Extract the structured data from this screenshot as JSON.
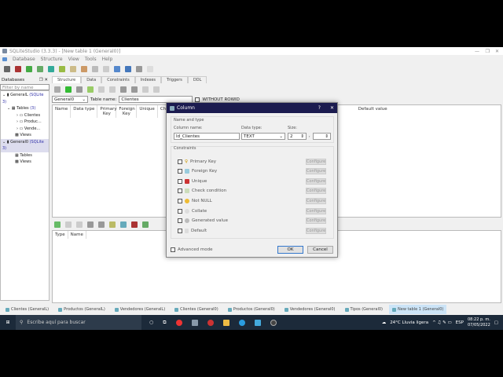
{
  "window": {
    "title": "SQLiteStudio (3.3.3) - [New table 1 (General0)]"
  },
  "menu": [
    "Database",
    "Structure",
    "View",
    "Tools",
    "Help"
  ],
  "databases_panel": {
    "title": "Databases",
    "filter_placeholder": "Filter by name",
    "tree": [
      {
        "label": "GeneralL",
        "badge": "(SQLite 3)"
      },
      {
        "label": "Tables",
        "badge": "(3)"
      },
      {
        "label": "Clientes"
      },
      {
        "label": "Produc..."
      },
      {
        "label": "Vende..."
      },
      {
        "label": "Views"
      },
      {
        "label": "General0",
        "badge": "(SQLite 3)"
      },
      {
        "label": "Tables"
      },
      {
        "label": "Views"
      }
    ]
  },
  "editor": {
    "tabs": [
      "Structure",
      "Data",
      "Constraints",
      "Indexes",
      "Triggers",
      "DDL"
    ],
    "active_tab": "Structure",
    "database_select": "General0",
    "table_name_label": "Table name:",
    "table_name": "Clientes",
    "without_rowid": "WITHOUT ROWID",
    "columns": [
      "Name",
      "Data type",
      "Primary Key",
      "Foreign Key",
      "Unique",
      "Check",
      "N N",
      "Default value"
    ],
    "lower_columns": [
      "Type",
      "Name"
    ]
  },
  "dialog": {
    "title": "Column",
    "help": "?",
    "close": "✕",
    "name_and_type": "Name and type",
    "column_name_label": "Column name:",
    "column_name": "Id_Clientes",
    "data_type_label": "Data type:",
    "data_type": "TEXT",
    "size_label": "Size:",
    "size": "2",
    "size2": "",
    "constraints_label": "Constraints",
    "constraints": [
      "Primary Key",
      "Foreign Key",
      "Unique",
      "Check condition",
      "Not NULL",
      "Collate",
      "Generated value",
      "Default"
    ],
    "configure": "Configure",
    "advanced_mode": "Advanced mode",
    "ok": "OK",
    "cancel": "Cancel"
  },
  "window_tabs": [
    {
      "label": "Clientes (GeneralL)"
    },
    {
      "label": "Productos (GeneralL)"
    },
    {
      "label": "Vendedores (GeneralL)"
    },
    {
      "label": "Clientes (General0)"
    },
    {
      "label": "Productos (General0)"
    },
    {
      "label": "Vendedores (General0)"
    },
    {
      "label": "Tipos (General0)"
    },
    {
      "label": "New table 1 (General0)",
      "active": true
    }
  ],
  "taskbar": {
    "search": "Escribe aquí para buscar",
    "weather": "24°C  Lluvia ligera",
    "lang": "ESP",
    "time": "08:22 p. m.",
    "date": "07/05/2022"
  }
}
